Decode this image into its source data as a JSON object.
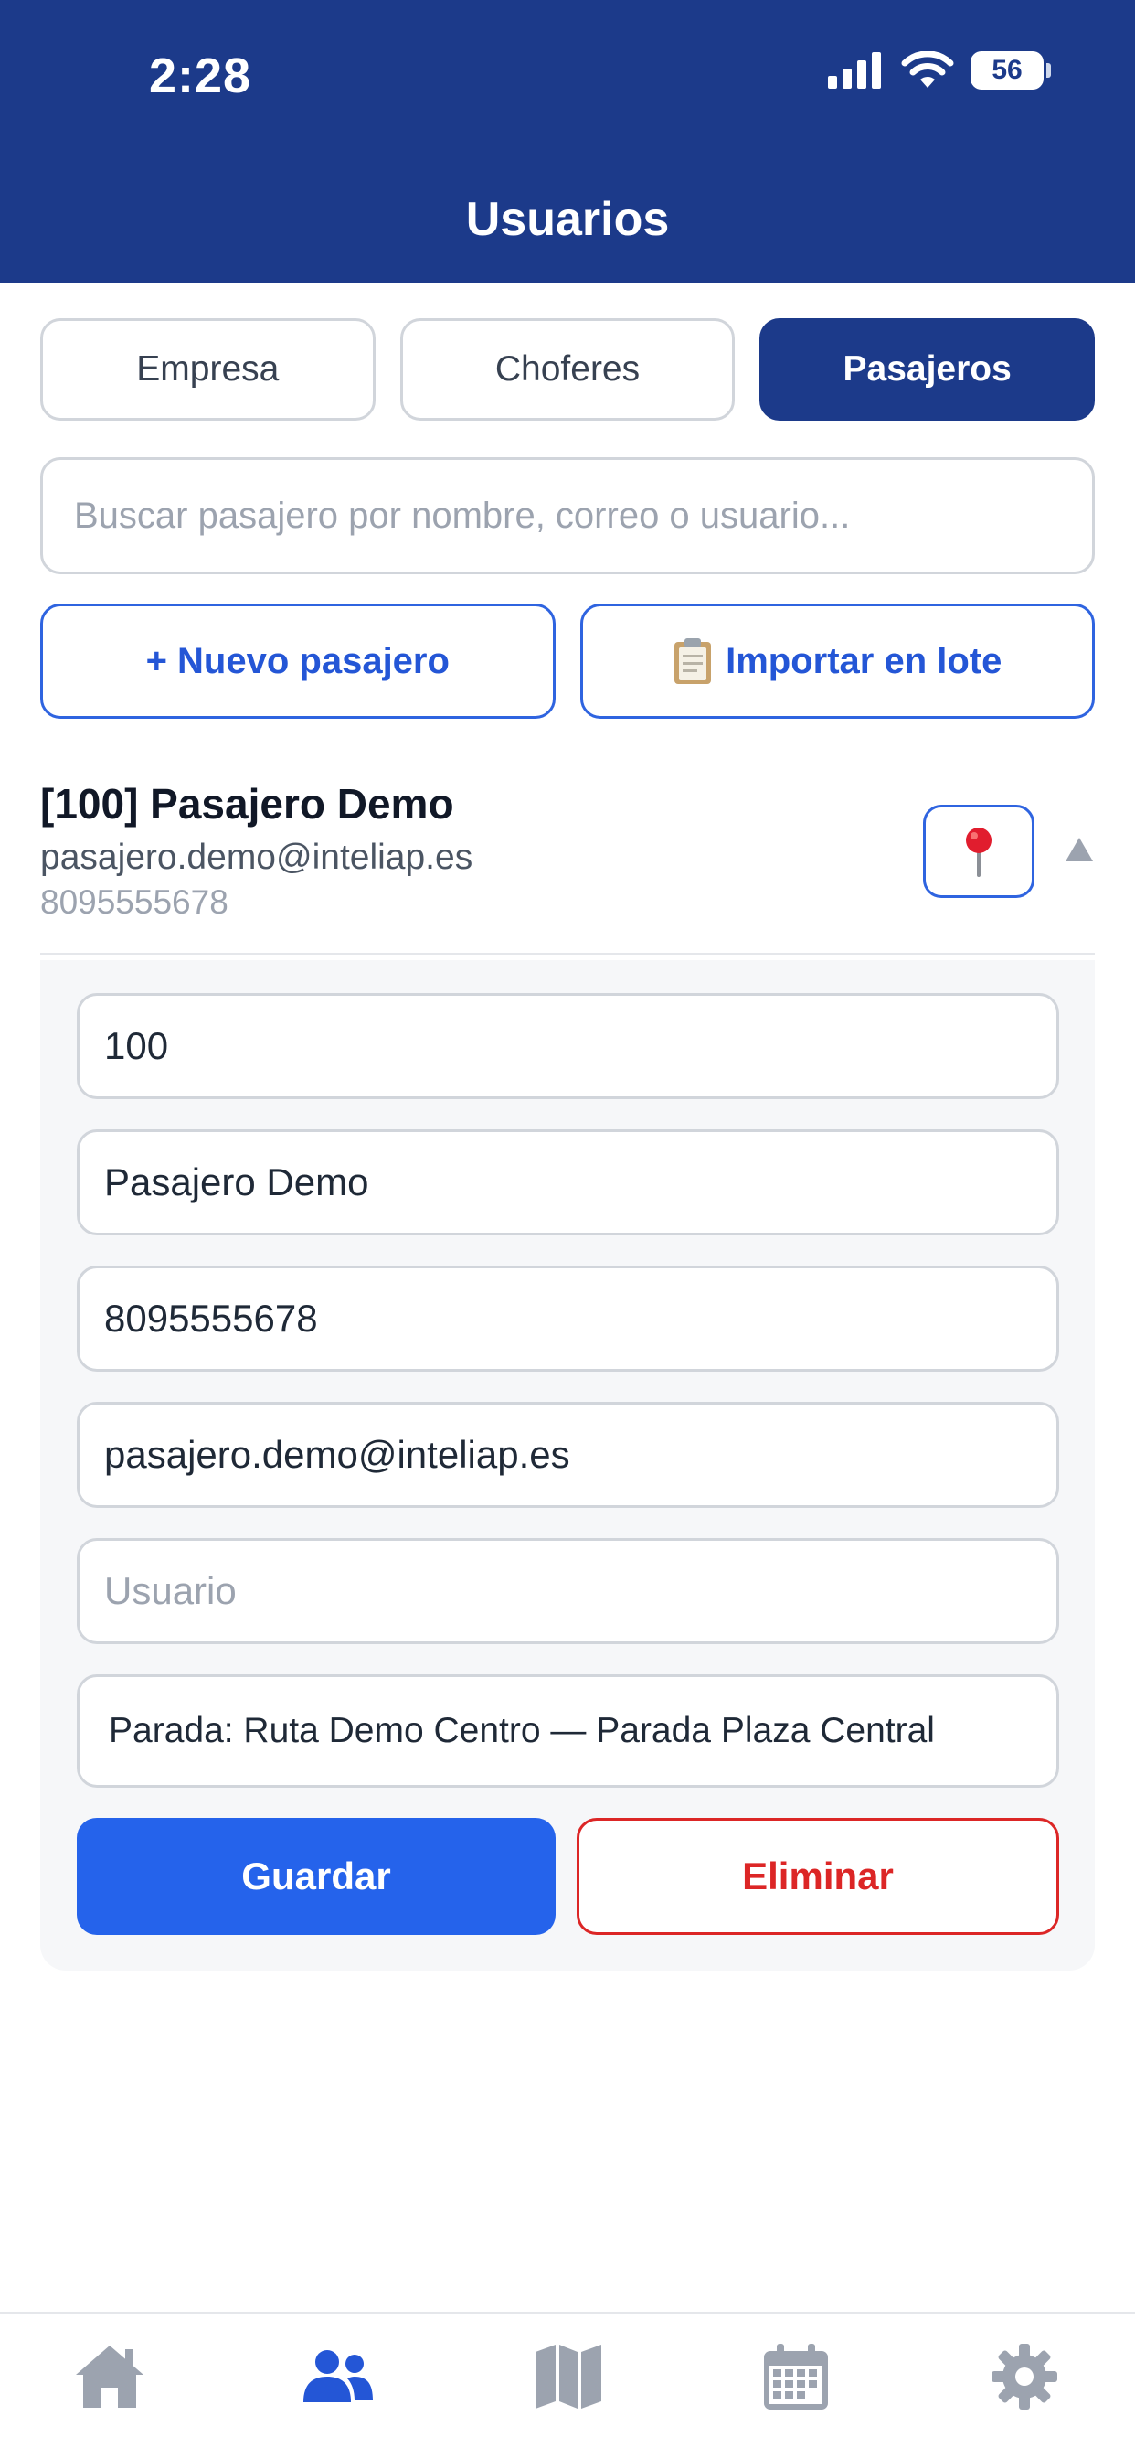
{
  "status_bar": {
    "time": "2:28",
    "battery": "56"
  },
  "header": {
    "title": "Usuarios"
  },
  "tabs": [
    {
      "label": "Empresa",
      "active": false
    },
    {
      "label": "Choferes",
      "active": false
    },
    {
      "label": "Pasajeros",
      "active": true
    }
  ],
  "search": {
    "placeholder": "Buscar pasajero por nombre, correo o usuario..."
  },
  "actions": {
    "new_label": "+ Nuevo pasajero",
    "import_label": "Importar en lote"
  },
  "passenger": {
    "title": "[100] Pasajero Demo",
    "email": "pasajero.demo@inteliap.es",
    "phone": "8095555678"
  },
  "form": {
    "id_value": "100",
    "name_value": "Pasajero Demo",
    "phone_value": "8095555678",
    "email_value": "pasajero.demo@inteliap.es",
    "user_placeholder": "Usuario",
    "stop_value": "Parada: Ruta Demo Centro — Parada Plaza Central",
    "save_label": "Guardar",
    "delete_label": "Eliminar"
  },
  "bottom_nav": [
    {
      "icon": "home-icon",
      "active": false
    },
    {
      "icon": "users-icon",
      "active": true
    },
    {
      "icon": "map-icon",
      "active": false
    },
    {
      "icon": "calendar-icon",
      "active": false
    },
    {
      "icon": "gear-icon",
      "active": false
    }
  ],
  "colors": {
    "primary": "#1c3a8a",
    "accent": "#2563eb",
    "danger": "#dc2626",
    "nav_inactive": "#9ca3af",
    "nav_active": "#2456d6"
  }
}
